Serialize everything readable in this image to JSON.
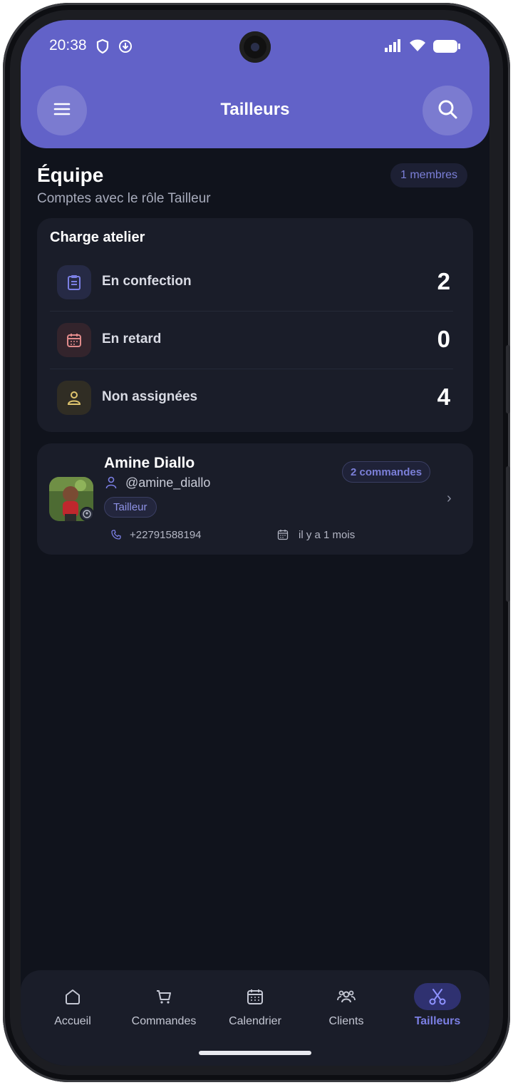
{
  "status_bar": {
    "time": "20:38"
  },
  "header": {
    "title": "Tailleurs"
  },
  "section": {
    "title": "Équipe",
    "subtitle": "Comptes avec le rôle Tailleur",
    "members_count": "1 membres"
  },
  "workload": {
    "title": "Charge atelier",
    "rows": [
      {
        "label": "En confection",
        "value": "2",
        "icon": "clipboard-icon"
      },
      {
        "label": "En retard",
        "value": "0",
        "icon": "calendar-icon"
      },
      {
        "label": "Non assignées",
        "value": "4",
        "icon": "person-icon"
      }
    ]
  },
  "members": [
    {
      "name": "Amine Diallo",
      "handle": "@amine_diallo",
      "role": "Tailleur",
      "orders": "2 commandes",
      "phone": "+22791588194",
      "joined": "il y a 1 mois"
    }
  ],
  "nav": [
    {
      "label": "Accueil",
      "icon": "home-icon",
      "active": false
    },
    {
      "label": "Commandes",
      "icon": "cart-icon",
      "active": false
    },
    {
      "label": "Calendrier",
      "icon": "calendar-icon",
      "active": false
    },
    {
      "label": "Clients",
      "icon": "clients-icon",
      "active": false
    },
    {
      "label": "Tailleurs",
      "icon": "scissors-icon",
      "active": true
    }
  ],
  "colors": {
    "accent": "#6262c8",
    "background": "#10131c",
    "card": "#1a1d29",
    "active_nav": "#7b7fe4"
  }
}
